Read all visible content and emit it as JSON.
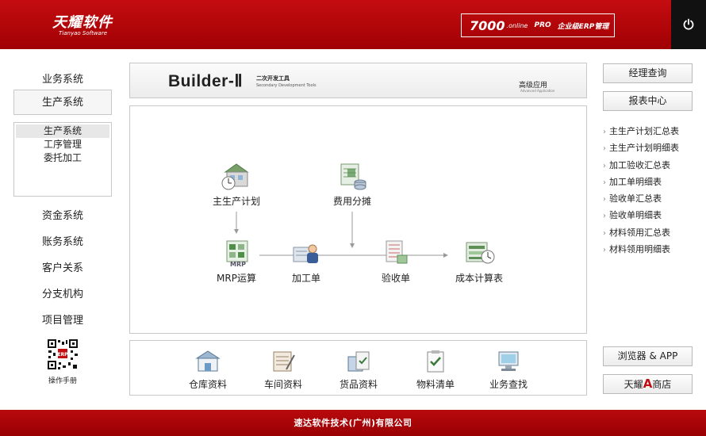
{
  "header": {
    "logo_cn": "天耀软件",
    "logo_en": "Tianyao Software",
    "brand_version": "7000",
    "brand_online": ".online",
    "brand_pro": "PRO",
    "brand_erp": "企业级ERP管理"
  },
  "leftnav": {
    "items": [
      "业务系统",
      "生产系统",
      "资金系统",
      "账务系统",
      "客户关系",
      "分支机构",
      "项目管理"
    ],
    "sub_items": [
      "生产系统",
      "工序管理",
      "委托加工"
    ],
    "qr_label": "操作手册"
  },
  "builder": {
    "title": "Builder-Ⅱ",
    "subtitle_cn": "二次开发工具",
    "subtitle_en": "Secondary Development Tools",
    "advanced_cn": "高级应用",
    "advanced_en": "Advanced Application"
  },
  "flow": {
    "nodes": {
      "master_plan": "主生产计划",
      "cost_alloc": "费用分摊",
      "mrp": "MRP运算",
      "process_order": "加工单",
      "acceptance": "验收单",
      "cost_calc": "成本计算表"
    }
  },
  "toolbar": {
    "items": [
      "仓库资料",
      "车间资料",
      "货品资料",
      "物料清单",
      "业务查找"
    ]
  },
  "right": {
    "manager_query": "经理查询",
    "report_center": "报表中心",
    "links": [
      "主生产计划汇总表",
      "主生产计划明细表",
      "加工验收汇总表",
      "加工单明细表",
      "验收单汇总表",
      "验收单明细表",
      "材料领用汇总表",
      "材料领用明细表"
    ],
    "browser_app": "浏览器 & APP",
    "shop_prefix": "天耀",
    "shop_a": "A",
    "shop_suffix": "商店"
  },
  "footer": {
    "company": "速达软件技术(广州)有限公司"
  },
  "colors": {
    "brand_red": "#c40d10",
    "dark_red": "#990003",
    "power_bg": "#111111"
  }
}
